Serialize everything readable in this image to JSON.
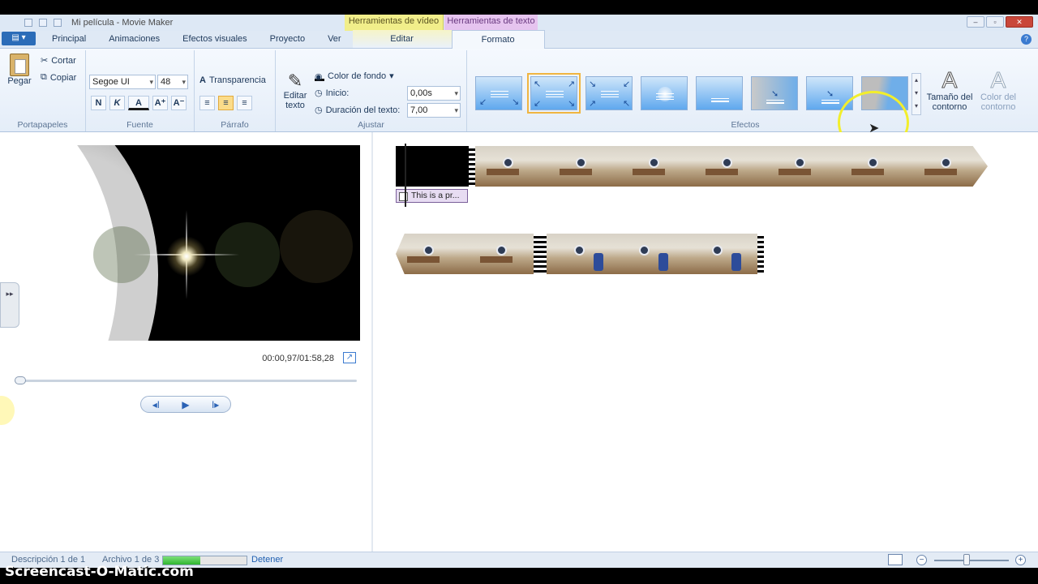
{
  "window": {
    "title": "Mi película - Movie Maker",
    "ctx_video": "Herramientas de vídeo",
    "ctx_text": "Herramientas de texto",
    "minimize": "–",
    "maximize": "▫",
    "close": "✕"
  },
  "tabs": {
    "app": "▤ ▾",
    "principal": "Principal",
    "animaciones": "Animaciones",
    "efectos": "Efectos visuales",
    "proyecto": "Proyecto",
    "ver": "Ver",
    "editar": "Editar",
    "formato": "Formato",
    "help": "?"
  },
  "ribbon": {
    "portapapeles": {
      "label": "Portapapeles",
      "pegar": "Pegar",
      "cortar": "Cortar",
      "copiar": "Copiar"
    },
    "fuente": {
      "label": "Fuente",
      "font": "Segoe UI",
      "size": "48",
      "bold": "N",
      "italic": "K",
      "color": "A",
      "grow": "A⁺",
      "shrink": "A⁻",
      "transparencia": "Transparencia"
    },
    "parrafo": {
      "label": "Párrafo"
    },
    "ajustar": {
      "label": "Ajustar",
      "editar": "Editar texto",
      "color_fondo": "Color de fondo",
      "inicio_label": "Inicio:",
      "inicio_value": "0,00s",
      "duracion_label": "Duración del texto:",
      "duracion_value": "7,00"
    },
    "efectos": {
      "label": "Efectos",
      "tamano": "Tamaño del contorno",
      "color": "Color del contorno"
    }
  },
  "player": {
    "timecode": "00:00,97/01:58,28",
    "prev": "◂ǀ",
    "play": "▶",
    "next": "ǀ▸",
    "side": "▸▸"
  },
  "storyboard": {
    "caption": "This is a pr..."
  },
  "status": {
    "descripcion": "Descripción 1 de 1",
    "archivo": "Archivo 1 de 3",
    "detener": "Detener",
    "progress": 0.45
  },
  "watermark": "Screencast-O-Matic.com"
}
